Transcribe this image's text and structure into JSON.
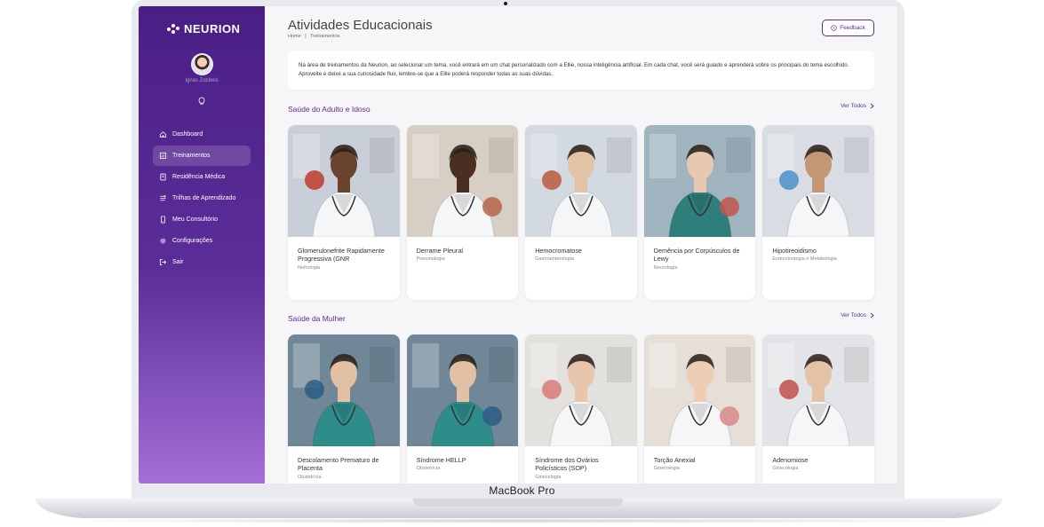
{
  "device": {
    "label": "MacBook Pro"
  },
  "sidebar": {
    "logo_text": "NEURION",
    "user_name": "Ignas Zocbeis",
    "items": [
      {
        "label": "Dashboard",
        "icon": "home-icon"
      },
      {
        "label": "Treinamentos",
        "icon": "chart-icon",
        "active": true
      },
      {
        "label": "Residência Médica",
        "icon": "book-icon"
      },
      {
        "label": "Trilhas de Aprendizado",
        "icon": "route-icon"
      },
      {
        "label": "Meu Consultório",
        "icon": "phone-icon"
      },
      {
        "label": "Configurações",
        "icon": "gear-icon"
      },
      {
        "label": "Sair",
        "icon": "logout-icon"
      }
    ]
  },
  "header": {
    "title": "Atividades Educacionais",
    "breadcrumb": [
      "Home",
      "|",
      "Treinamentos"
    ],
    "feedback_label": "Feedback"
  },
  "intro": {
    "text": "Na área de treinamentos da Neurion, ao selecionar um tema, você entrará em um chat personalizado com a Ellie, nossa inteligência artificial. Em cada chat, você será guiado e aprenderá sobre os principais do tema escolhido. Aproveite e deixe a sua curiosidade fluir, lembre-se que a Ellie poderá responder todas as suas dúvidas."
  },
  "sections": [
    {
      "title": "Saúde do Adulto e Idoso",
      "see_all": "Ver Todos",
      "cards": [
        {
          "title": "Glomerulonefrite Rapidamente Progressiva (GNR",
          "subtitle": "Nefrologia",
          "bg": "#c9cfd8",
          "coat": "#f4f6f8",
          "skin": "#6b4430",
          "accent": "#c0392b"
        },
        {
          "title": "Derrame Pleural",
          "subtitle": "Pneumologia",
          "bg": "#d8cfc4",
          "coat": "#f4f6f8",
          "skin": "#4a2e22",
          "accent": "#b5654a"
        },
        {
          "title": "Hemocromatose",
          "subtitle": "Gastroenterologia",
          "bg": "#d3d9e0",
          "coat": "#f4f6f8",
          "skin": "#e3c3a6",
          "accent": "#b85a3c"
        },
        {
          "title": "Demência por Corpúsculos de Lewy",
          "subtitle": "Neurologia",
          "bg": "#9fb4bf",
          "coat": "#2e7f7c",
          "skin": "#e8c9b0",
          "accent": "#c2554a"
        },
        {
          "title": "Hipotireoidismo",
          "subtitle": "Endocrinologia e Metabologia",
          "bg": "#d9dde3",
          "coat": "#f4f6f8",
          "skin": "#c49774",
          "accent": "#4a90c9"
        }
      ]
    },
    {
      "title": "Saúde da Mulher",
      "see_all": "Ver Todos",
      "cards": [
        {
          "title": "Descolamento Prematuro de Placenta",
          "subtitle": "Obstetrícia",
          "bg": "#6f8797",
          "coat": "#2e8d8a",
          "skin": "#e2c0a4",
          "accent": "#2b5d85"
        },
        {
          "title": "Síndrome HELLP",
          "subtitle": "Obstetrícia",
          "bg": "#6f8797",
          "coat": "#2e8d8a",
          "skin": "#e2c0a4",
          "accent": "#2b5d85"
        },
        {
          "title": "Síndrome dos Ovários Policísticos (SOP)",
          "subtitle": "Ginecologia",
          "bg": "#e3e1dd",
          "coat": "#f4f6f8",
          "skin": "#e7c6ab",
          "accent": "#d77a7a"
        },
        {
          "title": "Torção Anexial",
          "subtitle": "Ginecologia",
          "bg": "#e6dfd8",
          "coat": "#f4f6f8",
          "skin": "#edcdb3",
          "accent": "#d98a8a"
        },
        {
          "title": "Adenomiose",
          "subtitle": "Ginecologia",
          "bg": "#e2e4e7",
          "coat": "#f4f6f8",
          "skin": "#e4c2a5",
          "accent": "#c0504a"
        }
      ]
    }
  ],
  "colors": {
    "brand": "#5b2d99",
    "sidebar_top": "#4a1f85",
    "sidebar_bottom": "#a46fd6"
  }
}
